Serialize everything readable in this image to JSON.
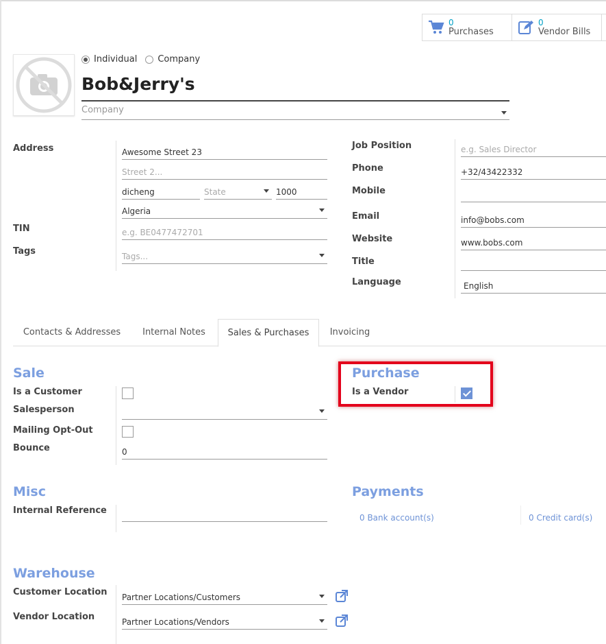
{
  "smart_buttons": [
    {
      "count": "0",
      "label": "Purchases",
      "icon": "cart-icon"
    },
    {
      "count": "0",
      "label": "Vendor Bills",
      "icon": "edit-bill-icon"
    }
  ],
  "partner_type": {
    "individual": "Individual",
    "company": "Company",
    "selected": "Individual"
  },
  "name": "Bob&Jerry's",
  "company_placeholder": "Company",
  "address": {
    "label": "Address",
    "street": "Awesome Street 23",
    "street2_placeholder": "Street 2...",
    "city": "dicheng",
    "state_placeholder": "State",
    "zip": "1000",
    "country": "Algeria"
  },
  "tin": {
    "label": "TIN",
    "placeholder": "e.g. BE0477472701"
  },
  "tags": {
    "label": "Tags",
    "placeholder": "Tags..."
  },
  "contact": {
    "job_position": {
      "label": "Job Position",
      "placeholder": "e.g. Sales Director"
    },
    "phone": {
      "label": "Phone",
      "value": "+32/43422332"
    },
    "mobile": {
      "label": "Mobile",
      "value": ""
    },
    "email": {
      "label": "Email",
      "value": "info@bobs.com"
    },
    "website": {
      "label": "Website",
      "value": "www.bobs.com"
    },
    "title": {
      "label": "Title",
      "value": ""
    },
    "language": {
      "label": "Language",
      "value": "English"
    }
  },
  "tabs": [
    "Contacts & Addresses",
    "Internal Notes",
    "Sales & Purchases",
    "Invoicing"
  ],
  "active_tab": "Sales & Purchases",
  "sale": {
    "title": "Sale",
    "is_customer": {
      "label": "Is a Customer",
      "checked": false
    },
    "salesperson": {
      "label": "Salesperson",
      "value": ""
    },
    "mailing_opt_out": {
      "label": "Mailing Opt-Out",
      "checked": false
    },
    "bounce": {
      "label": "Bounce",
      "value": "0"
    }
  },
  "purchase": {
    "title": "Purchase",
    "is_vendor": {
      "label": "Is a Vendor",
      "checked": true
    }
  },
  "misc": {
    "title": "Misc",
    "internal_reference": {
      "label": "Internal Reference",
      "value": ""
    }
  },
  "payments": {
    "title": "Payments",
    "bank_accounts": "0 Bank account(s)",
    "credit_cards": "0 Credit card(s)"
  },
  "warehouse": {
    "title": "Warehouse",
    "customer_location": {
      "label": "Customer Location",
      "value": "Partner Locations/Customers"
    },
    "vendor_location": {
      "label": "Vendor Location",
      "value": "Partner Locations/Vendors"
    }
  },
  "colors": {
    "accent": "#7c9fe0",
    "link": "#00a0c6",
    "highlight": "#e3001b",
    "checkbox": "#6d92d6"
  }
}
